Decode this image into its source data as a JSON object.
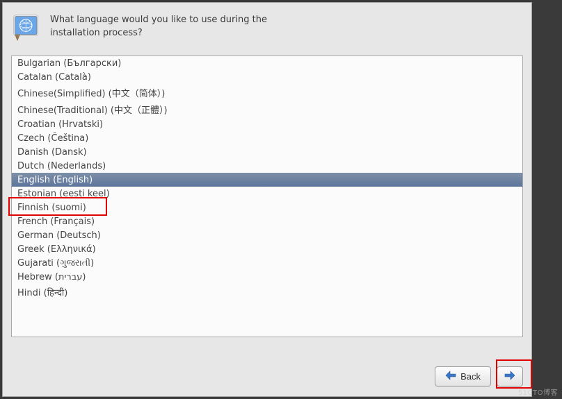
{
  "header": {
    "prompt": "What language would you like to use during the installation process?"
  },
  "languages": [
    {
      "label": "Bulgarian (Български)",
      "selected": false
    },
    {
      "label": "Catalan (Català)",
      "selected": false
    },
    {
      "label": "Chinese(Simplified) (中文（简体）)",
      "selected": false
    },
    {
      "label": "Chinese(Traditional) (中文（正體）)",
      "selected": false
    },
    {
      "label": "Croatian (Hrvatski)",
      "selected": false
    },
    {
      "label": "Czech (Čeština)",
      "selected": false
    },
    {
      "label": "Danish (Dansk)",
      "selected": false
    },
    {
      "label": "Dutch (Nederlands)",
      "selected": false
    },
    {
      "label": "English (English)",
      "selected": true
    },
    {
      "label": "Estonian (eesti keel)",
      "selected": false
    },
    {
      "label": "Finnish (suomi)",
      "selected": false
    },
    {
      "label": "French (Français)",
      "selected": false
    },
    {
      "label": "German (Deutsch)",
      "selected": false
    },
    {
      "label": "Greek (Ελληνικά)",
      "selected": false
    },
    {
      "label": "Gujarati (ગુજરાતી)",
      "selected": false
    },
    {
      "label": "Hebrew (עברית)",
      "selected": false
    },
    {
      "label": "Hindi (हिन्दी)",
      "selected": false
    }
  ],
  "buttons": {
    "back": "Back",
    "next": ""
  },
  "watermark": "51CTO博客"
}
